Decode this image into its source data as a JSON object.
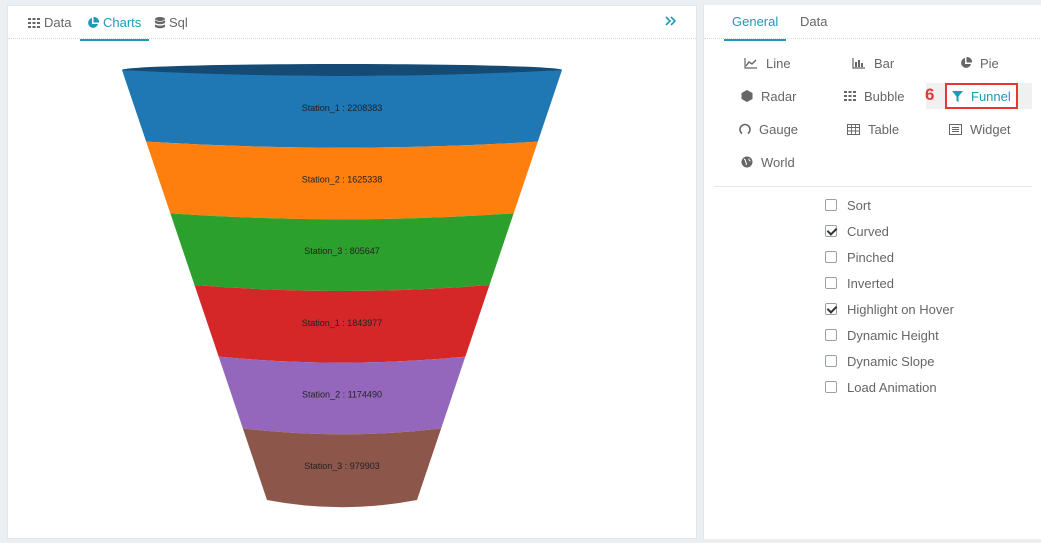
{
  "left_tabs": [
    {
      "label": "Data",
      "icon": "grid-icon"
    },
    {
      "label": "Charts",
      "icon": "pie-chart-icon",
      "active": true
    },
    {
      "label": "Sql",
      "icon": "database-icon"
    }
  ],
  "collapse_icon": "double-chevron-right-icon",
  "right_tabs": [
    {
      "label": "General",
      "active": true
    },
    {
      "label": "Data"
    }
  ],
  "chart_types": [
    {
      "label": "Line",
      "icon": "line-chart-icon"
    },
    {
      "label": "Bar",
      "icon": "bar-chart-icon"
    },
    {
      "label": "Pie",
      "icon": "pie-chart-icon"
    },
    {
      "label": "Radar",
      "icon": "radar-icon"
    },
    {
      "label": "Bubble",
      "icon": "bubble-grid-icon"
    },
    {
      "label": "Funnel",
      "icon": "funnel-icon",
      "selected": true
    },
    {
      "label": "Gauge",
      "icon": "gauge-icon"
    },
    {
      "label": "Table",
      "icon": "table-icon"
    },
    {
      "label": "Widget",
      "icon": "widget-icon"
    },
    {
      "label": "World",
      "icon": "globe-icon"
    }
  ],
  "step_badge": "6",
  "options": [
    {
      "label": "Sort",
      "checked": false
    },
    {
      "label": "Curved",
      "checked": true
    },
    {
      "label": "Pinched",
      "checked": false
    },
    {
      "label": "Inverted",
      "checked": false
    },
    {
      "label": "Highlight on Hover",
      "checked": true
    },
    {
      "label": "Dynamic Height",
      "checked": false
    },
    {
      "label": "Dynamic Slope",
      "checked": false
    },
    {
      "label": "Load Animation",
      "checked": false
    }
  ],
  "colors": {
    "accent": "#1e9ab8",
    "highlight": "#e53935"
  },
  "chart_data": {
    "type": "funnel",
    "curved": true,
    "segments": [
      {
        "label": "Station_1 : 2208383",
        "name": "Station_1",
        "value": 2208383,
        "color": "#1f77b4"
      },
      {
        "label": "Station_2 : 1625338",
        "name": "Station_2",
        "value": 1625338,
        "color": "#ff7f0e"
      },
      {
        "label": "Station_3 : 805647",
        "name": "Station_3",
        "value": 805647,
        "color": "#2ca02c"
      },
      {
        "label": "Station_1 : 1843977",
        "name": "Station_1",
        "value": 1843977,
        "color": "#d62728"
      },
      {
        "label": "Station_2 : 1174490",
        "name": "Station_2",
        "value": 1174490,
        "color": "#9467bd"
      },
      {
        "label": "Station_3 : 979903",
        "name": "Station_3",
        "value": 979903,
        "color": "#8c564b"
      }
    ]
  }
}
